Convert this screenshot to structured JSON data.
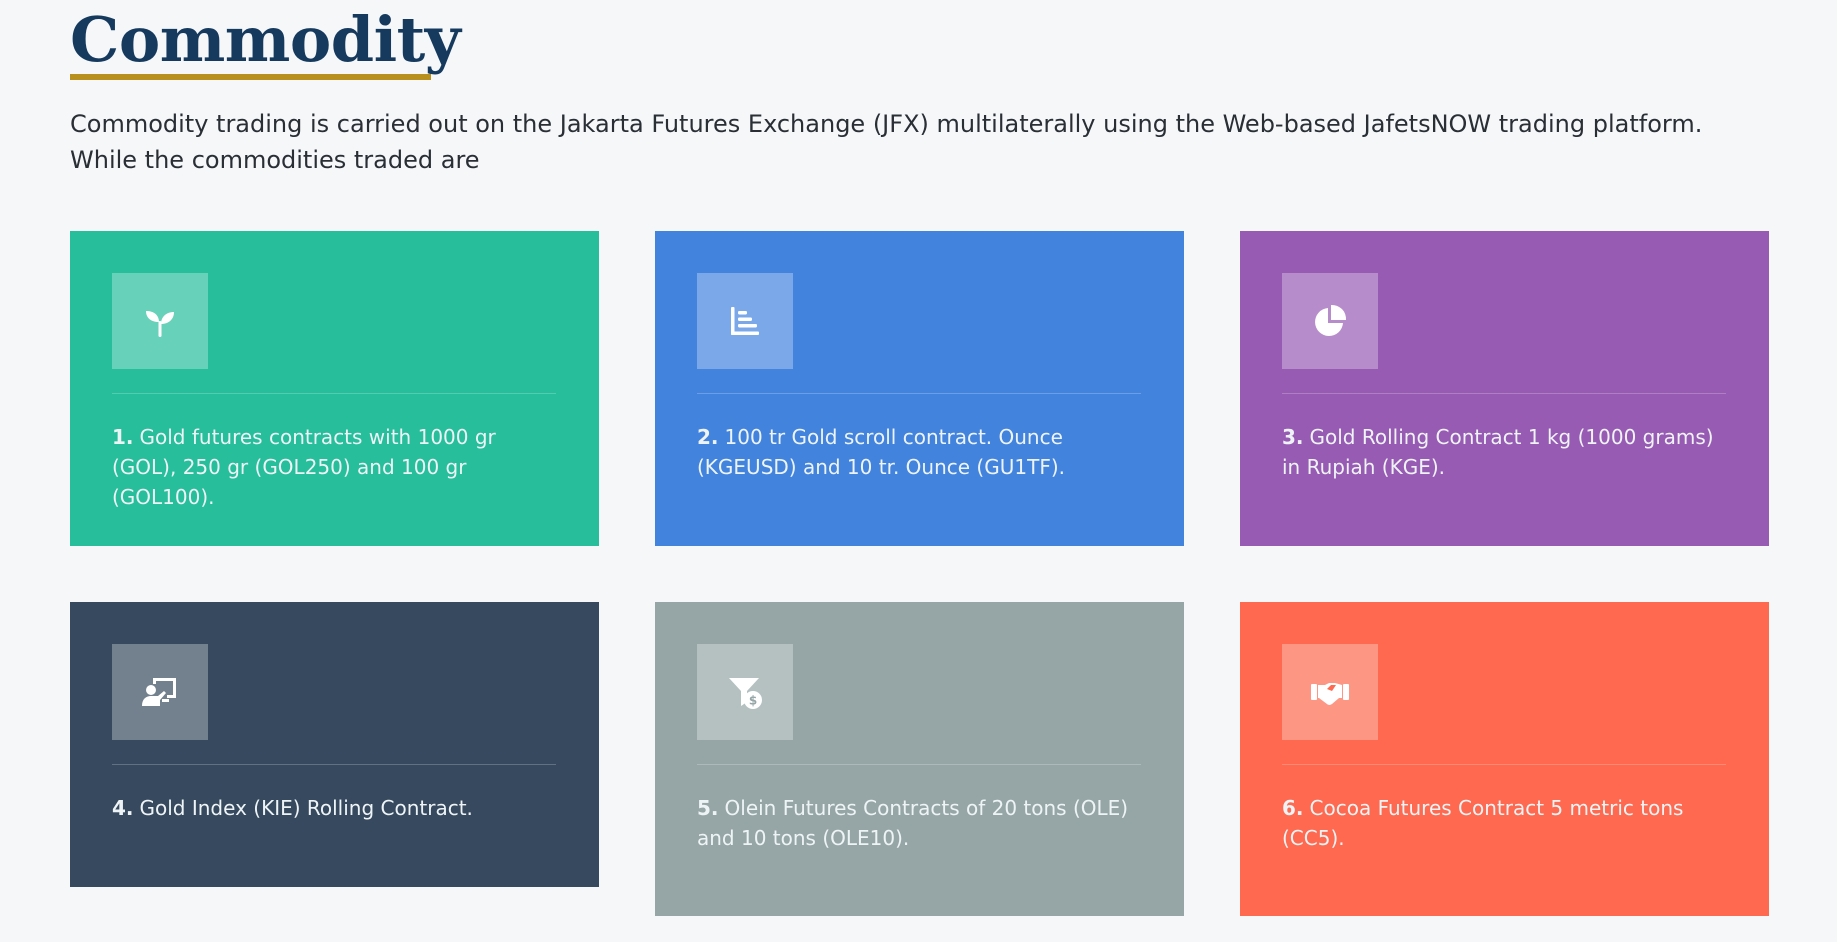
{
  "header": {
    "title": "Commodity",
    "intro": "Commodity trading is carried out on the Jakarta Futures Exchange (JFX) multilaterally using the Web-based JafetsNOW trading platform. While the commodities traded are"
  },
  "colors": {
    "title": "#163a5e",
    "underline": "#b8901d",
    "card1": "#26be9b",
    "card2": "#4283de",
    "card3": "#985bb3",
    "card4": "#37495e",
    "card5": "#96a6a7",
    "card6": "#fe6950"
  },
  "cards": [
    {
      "number": "1.",
      "text": "Gold futures contracts with 1000 gr (GOL), 250 gr (GOL250) and 100 gr (GOL100).",
      "icon": "seedling-icon"
    },
    {
      "number": "2.",
      "text": "100 tr Gold scroll contract. Ounce (KGEUSD) and 10 tr. Ounce (GU1TF).",
      "icon": "bar-chart-icon"
    },
    {
      "number": "3.",
      "text": "Gold Rolling Contract 1 kg (1000 grams) in Rupiah (KGE).",
      "icon": "pie-chart-icon"
    },
    {
      "number": "4.",
      "text": "Gold Index (KIE) Rolling Contract.",
      "icon": "presenter-icon"
    },
    {
      "number": "5.",
      "text": "Olein Futures Contracts of 20 tons (OLE) and 10 tons (OLE10).",
      "icon": "funnel-dollar-icon"
    },
    {
      "number": "6.",
      "text": "Cocoa Futures Contract 5 metric tons (CC5).",
      "icon": "handshake-icon"
    }
  ]
}
